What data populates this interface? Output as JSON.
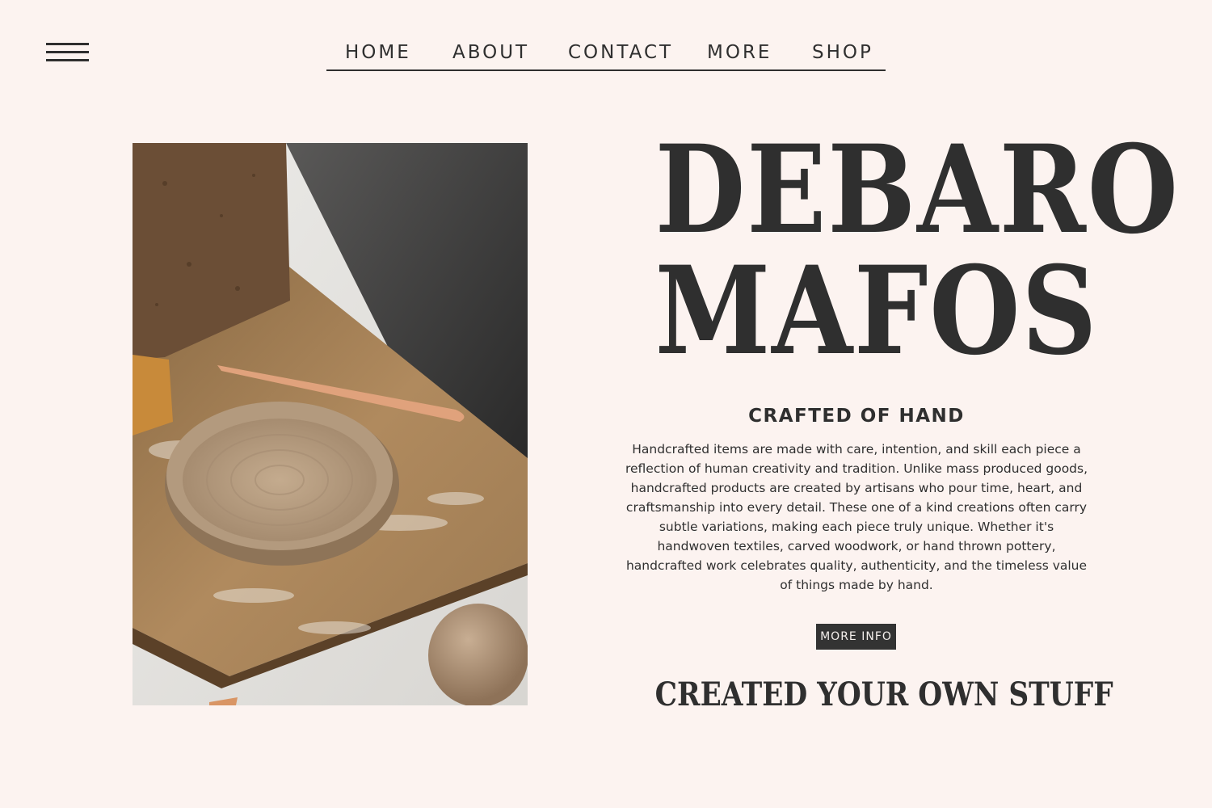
{
  "nav": {
    "menu_icon": "hamburger-menu-icon",
    "items": [
      {
        "label": "HOME"
      },
      {
        "label": "ABOUT"
      },
      {
        "label": "CONTACT"
      },
      {
        "label": "MORE"
      },
      {
        "label": "SHOP"
      }
    ]
  },
  "hero": {
    "title_line1": "DEBARO",
    "title_line2": "MAFOS",
    "subtitle": "CRAFTED OF HAND",
    "description": "Handcrafted items are made with care, intention, and skill each piece a reflection of human creativity and tradition. Unlike mass produced goods, handcrafted products are created by artisans who pour time, heart, and craftsmanship into every detail. These one of a kind creations often carry subtle variations, making each piece truly unique. Whether it's handwoven textiles, carved woodwork, or hand thrown pottery, handcrafted work celebrates quality, authenticity, and the timeless value of things made by hand.",
    "button_label": "MORE INFO",
    "tagline": "CREATED YOUR OWN STUFF"
  },
  "image": {
    "subject": "pottery-clay-plate-photo"
  },
  "colors": {
    "background": "#fcf3f0",
    "text": "#2f2f2f",
    "button_bg": "#333333"
  }
}
